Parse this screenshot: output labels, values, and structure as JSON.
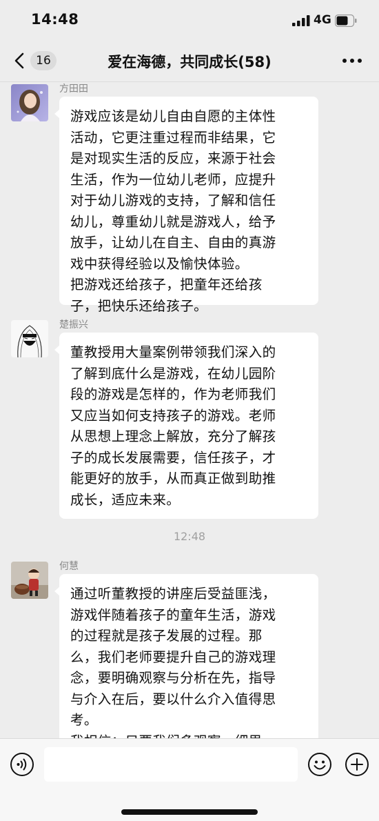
{
  "status_bar": {
    "time": "14:48",
    "network": "4G"
  },
  "nav": {
    "back_count": "16",
    "title": "爱在海德，共同成长(58)"
  },
  "messages": [
    {
      "sender": "方田田",
      "avatar_icon": "girl-illustration-avatar",
      "text": "游戏应该是幼儿自由自愿的主体性\n活动，它更注重过程而非结果，它\n是对现实生活的反应，来源于社会\n生活，作为一位幼儿老师，应提升\n对于幼儿游戏的支持，了解和信任\n幼儿，尊重幼儿就是游戏人，给予\n放手，让幼儿在自主、自由的真游\n戏中获得经验以及愉快体验。\n把游戏还给孩子，把童年还给孩\n子，把快乐还给孩子。"
    },
    {
      "sender": "楚振兴",
      "avatar_icon": "ninja-sketch-avatar",
      "text": "董教授用大量案例带领我们深入的\n了解到底什么是游戏，在幼儿园阶\n段的游戏是怎样的，作为老师我们\n又应当如何支持孩子的游戏。老师\n从思想上理念上解放，充分了解孩\n子的成长发展需要，信任孩子，才\n能更好的放手，从而真正做到助推\n成长，适应未来。"
    },
    {
      "sender": "何慧",
      "avatar_icon": "doll-photo-avatar",
      "text": "通过听董教授的讲座后受益匪浅，\n游戏伴随着孩子的童年生活，游戏\n的过程就是孩子发展的过程。那\n么，我们老师要提升自己的游戏理\n念，要明确观察与分析在先，指导\n与介入在后，要以什么介入值得思\n考。\n我相信：只要我们多观察、细思"
    }
  ],
  "time_divider": "12:48",
  "input": {
    "placeholder": ""
  },
  "colors": {
    "background": "#ededed",
    "bubble": "#ffffff",
    "sender": "#888888",
    "timestamp": "#a0a0a0"
  }
}
